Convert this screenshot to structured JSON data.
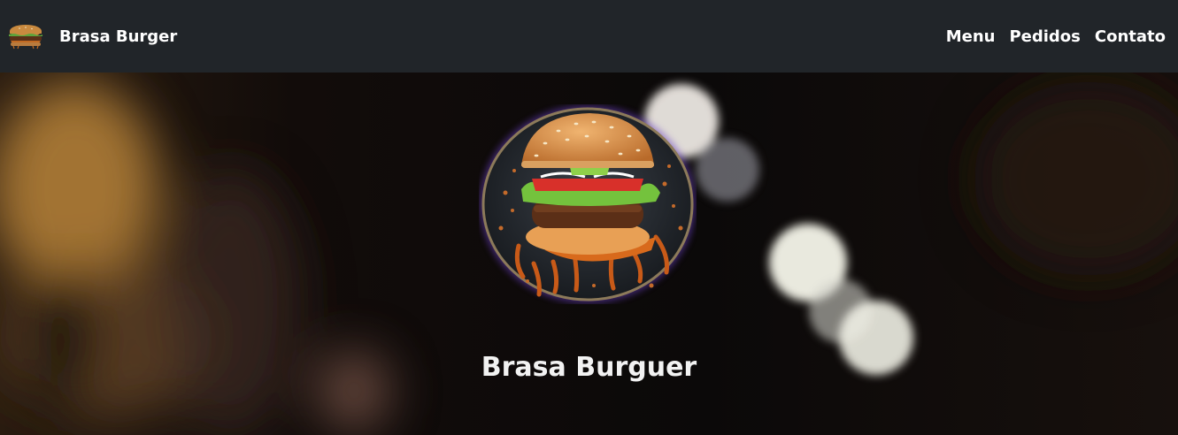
{
  "navbar": {
    "brand_name": "Brasa Burger",
    "logo_icon": "burger-icon",
    "links": [
      {
        "label": "Menu"
      },
      {
        "label": "Pedidos"
      },
      {
        "label": "Contato"
      }
    ]
  },
  "hero": {
    "title": "Brasa Burguer",
    "logo_icon": "burger-photo-icon",
    "background": "blurred-bokeh-photo"
  },
  "colors": {
    "navbar_bg": "#212529",
    "text": "#ffffff",
    "glow": "#6a3fc4"
  }
}
